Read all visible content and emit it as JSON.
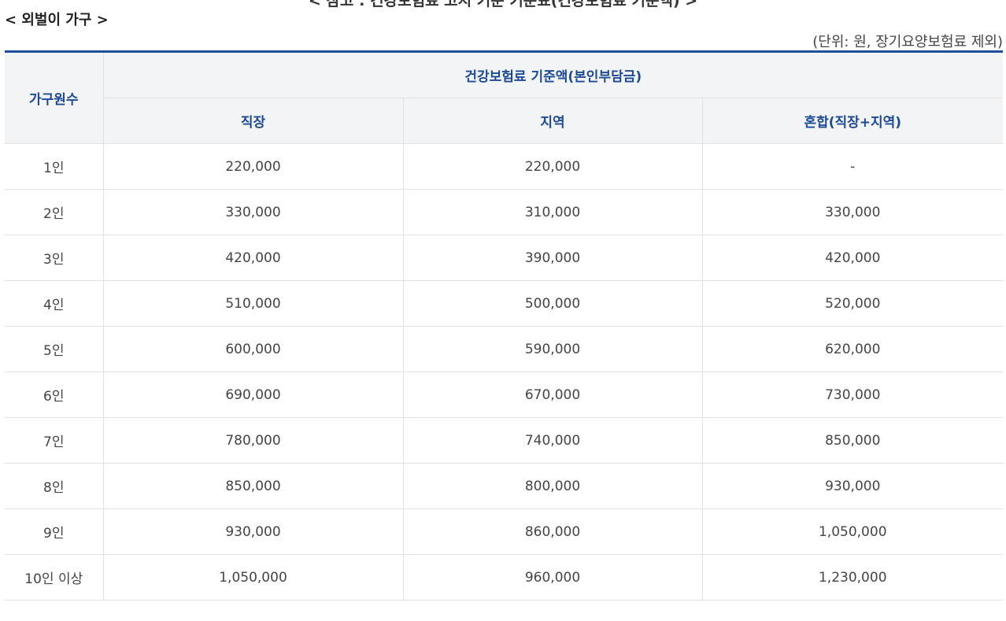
{
  "top_caption": "< 참고 : 건강보험료 고시 기준 기준표(건강보험료 기준액) >",
  "section_title": "< 외벌이 가구 >",
  "unit_note": "(단위: 원, 장기요양보험료 제외)",
  "table": {
    "header_household": "가구원수",
    "header_group": "건강보험료 기준액(본인부담금)",
    "columns": [
      "직장",
      "지역",
      "혼합(직장+지역)"
    ],
    "rows": [
      {
        "household": "1인",
        "workplace": "220,000",
        "regional": "220,000",
        "mixed": "-"
      },
      {
        "household": "2인",
        "workplace": "330,000",
        "regional": "310,000",
        "mixed": "330,000"
      },
      {
        "household": "3인",
        "workplace": "420,000",
        "regional": "390,000",
        "mixed": "420,000"
      },
      {
        "household": "4인",
        "workplace": "510,000",
        "regional": "500,000",
        "mixed": "520,000"
      },
      {
        "household": "5인",
        "workplace": "600,000",
        "regional": "590,000",
        "mixed": "620,000"
      },
      {
        "household": "6인",
        "workplace": "690,000",
        "regional": "670,000",
        "mixed": "730,000"
      },
      {
        "household": "7인",
        "workplace": "780,000",
        "regional": "740,000",
        "mixed": "850,000"
      },
      {
        "household": "8인",
        "workplace": "850,000",
        "regional": "800,000",
        "mixed": "930,000"
      },
      {
        "household": "9인",
        "workplace": "930,000",
        "regional": "860,000",
        "mixed": "1,050,000"
      },
      {
        "household": "10인 이상",
        "workplace": "1,050,000",
        "regional": "960,000",
        "mixed": "1,230,000"
      }
    ]
  },
  "colors": {
    "header_text": "#1d4a96",
    "header_bg": "#f3f4f6",
    "top_border": "#1f4e9c"
  }
}
